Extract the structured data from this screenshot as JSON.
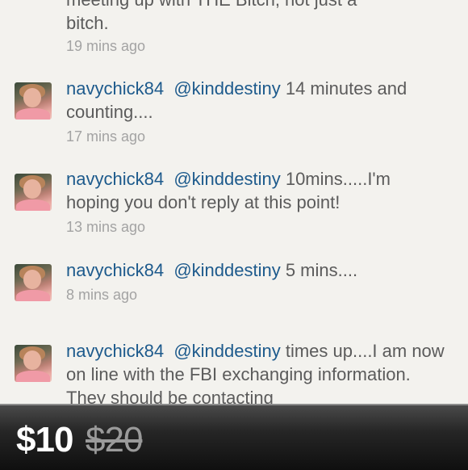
{
  "feed": {
    "top_tweet": {
      "text_line1": "meeting up with THE Bitch, not just a",
      "text_line2": "bitch.",
      "time": "19 mins ago"
    },
    "tweets": [
      {
        "user": "navychick84",
        "mention": "@kinddestiny",
        "text": " 14 minutes and counting....",
        "time": "17 mins ago"
      },
      {
        "user": "navychick84",
        "mention": "@kinddestiny",
        "text": " 10mins.....I'm hoping you don't reply at this point!",
        "time": "13 mins ago"
      },
      {
        "user": "navychick84",
        "mention": "@kinddestiny",
        "text": " 5 mins....",
        "time": "8 mins ago"
      },
      {
        "user": "navychick84",
        "mention": "@kinddestiny",
        "text": " times up....I am now on line with the FBI exchanging information. They should be contacting",
        "time": ""
      }
    ]
  },
  "price_bar": {
    "price": "$10",
    "original_price": "$20"
  },
  "colors": {
    "username": "#1d5a8c",
    "body_text": "#5b5b5b",
    "timestamp": "#a3a3a3",
    "background": "#f3f2ee"
  }
}
